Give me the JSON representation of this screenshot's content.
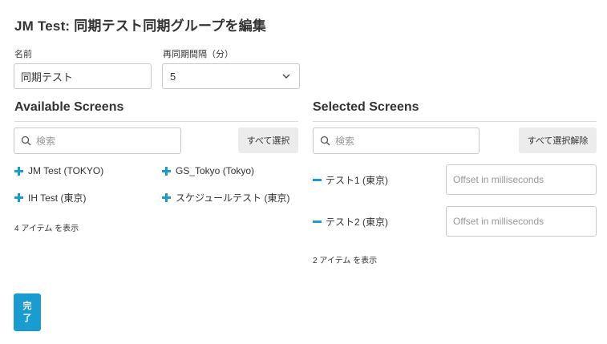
{
  "page": {
    "title": "JM Test: 同期テスト同期グループを編集"
  },
  "form": {
    "name_label": "名前",
    "name_value": "同期テスト",
    "interval_label": "再同期間隔（分）",
    "interval_value": "5"
  },
  "available": {
    "heading": "Available Screens",
    "search_placeholder": "検索",
    "select_all_label": "すべて選択",
    "items": [
      {
        "label": "JM Test (TOKYO)"
      },
      {
        "label": "GS_Tokyo (Tokyo)"
      },
      {
        "label": "IH Test (東京)"
      },
      {
        "label": "スケジュールテスト (東京)"
      }
    ],
    "count_text": "4 アイテム を表示"
  },
  "selected": {
    "heading": "Selected Screens",
    "search_placeholder": "検索",
    "deselect_all_label": "すべて選択解除",
    "items": [
      {
        "label": "テスト1 (東京)",
        "offset_placeholder": "Offset in milliseconds"
      },
      {
        "label": "テスト2 (東京)",
        "offset_placeholder": "Offset in milliseconds"
      }
    ],
    "count_text": "2 アイテム を表示"
  },
  "footer": {
    "done_label": "完了"
  },
  "colors": {
    "accent": "#1b9cd0",
    "button_gray": "#ececec",
    "border": "#c9c9c9"
  },
  "icons": {
    "search": "search-icon",
    "add": "plus-icon",
    "remove": "minus-icon",
    "dropdown": "chevron-down-icon"
  }
}
